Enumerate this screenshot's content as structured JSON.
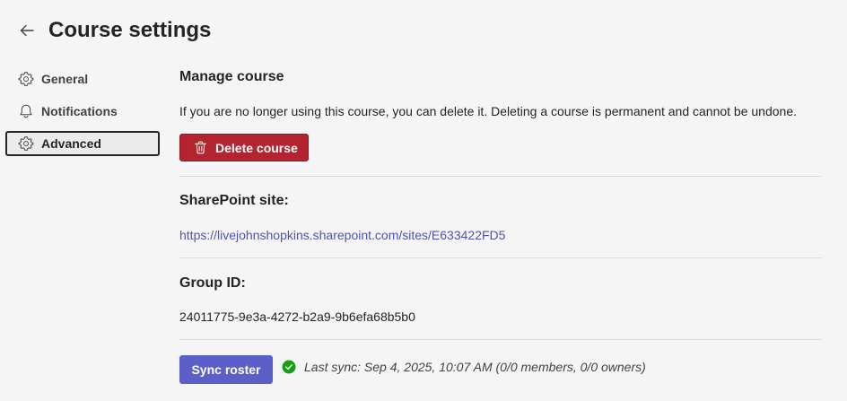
{
  "header": {
    "title": "Course settings",
    "back_icon": "arrow-left-icon"
  },
  "sidebar": {
    "items": [
      {
        "label": "General",
        "icon": "gear-icon",
        "active": false
      },
      {
        "label": "Notifications",
        "icon": "bell-icon",
        "active": false
      },
      {
        "label": "Advanced",
        "icon": "gear-icon",
        "active": true
      }
    ]
  },
  "manage": {
    "title": "Manage course",
    "description": "If you are no longer using this course, you can delete it. Deleting a course is permanent and cannot be undone.",
    "delete_label": "Delete course",
    "delete_icon": "trash-icon",
    "delete_color": "#b12430"
  },
  "sharepoint": {
    "title": "SharePoint site:",
    "url": "https://livejohnshopkins.sharepoint.com/sites/E633422FD5"
  },
  "group": {
    "title": "Group ID:",
    "id": "24011775-9e3a-4272-b2a9-9b6efa68b5b0"
  },
  "sync": {
    "button_label": "Sync roster",
    "button_color": "#5b5fc7",
    "status_icon": "check-circle-icon",
    "status_color": "#13a10e",
    "status_text": "Last sync: Sep 4, 2025, 10:07 AM (0/0 members, 0/0 owners)"
  }
}
